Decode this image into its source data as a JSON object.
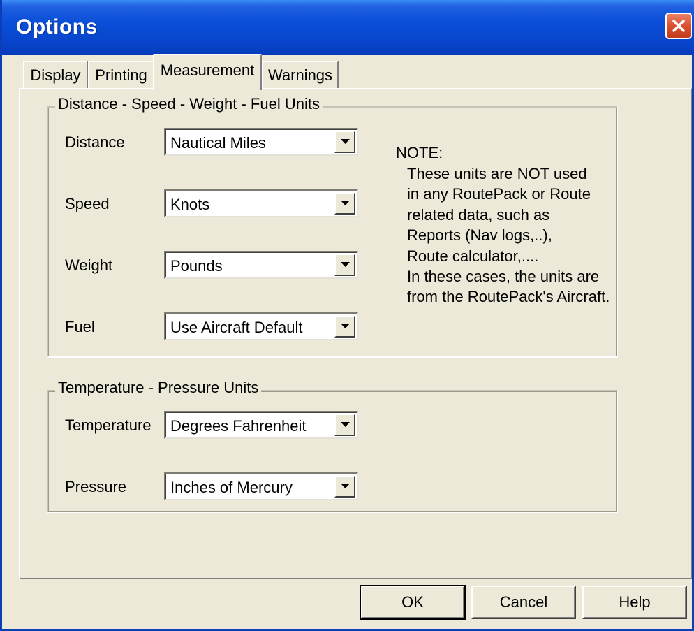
{
  "window": {
    "title": "Options"
  },
  "tabs": [
    {
      "label": "Display"
    },
    {
      "label": "Printing"
    },
    {
      "label": "Measurement"
    },
    {
      "label": "Warnings"
    }
  ],
  "units_group": {
    "title": "Distance - Speed - Weight - Fuel Units",
    "fields": [
      {
        "label": "Distance",
        "value": "Nautical Miles"
      },
      {
        "label": "Speed",
        "value": "Knots"
      },
      {
        "label": "Weight",
        "value": "Pounds"
      },
      {
        "label": "Fuel",
        "value": "Use Aircraft Default"
      }
    ],
    "note": {
      "heading": "NOTE:",
      "lines": [
        "These units are NOT used",
        "in any RoutePack or Route",
        "related data, such as",
        "Reports (Nav logs,..),",
        "Route calculator,....",
        "In these cases, the units are",
        "from the RoutePack's Aircraft."
      ]
    }
  },
  "temp_group": {
    "title": "Temperature - Pressure Units",
    "fields": [
      {
        "label": "Temperature",
        "value": "Degrees Fahrenheit"
      },
      {
        "label": "Pressure",
        "value": "Inches of Mercury"
      }
    ]
  },
  "buttons": {
    "ok": "OK",
    "cancel": "Cancel",
    "help": "Help"
  },
  "colors": {
    "titlebar": "#0845cc",
    "face": "#ece9d8",
    "close": "#d9512f"
  },
  "icons": {
    "close": "close-icon",
    "dropdown": "chevron-down-icon"
  }
}
